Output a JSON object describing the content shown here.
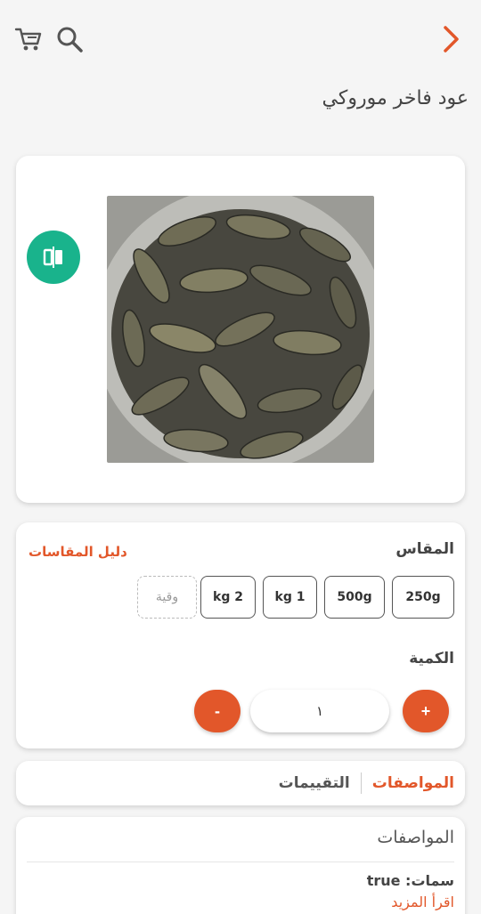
{
  "header": {
    "product_title": "عود فاخر موروكي"
  },
  "icons": {
    "back": "chevron-right-icon",
    "search": "search-icon",
    "cart": "cart-icon",
    "compare": "compare-icon"
  },
  "colors": {
    "accent": "#e2572a",
    "compare": "#19b38c"
  },
  "options": {
    "size_label": "المقاس",
    "size_guide_label": "دليل المقاسات",
    "sizes": [
      "250g",
      "500g",
      "1 kg",
      "2 kg",
      "وقية"
    ],
    "quantity_label": "الكمية",
    "plus_label": "+",
    "minus_label": "-",
    "quantity_value": "١"
  },
  "tabs": {
    "specs": "المواصفات",
    "reviews": "التقييمات"
  },
  "description": {
    "heading": "المواصفات",
    "attribute": "سمات: true",
    "read_more": "اقرأ المزيد"
  }
}
